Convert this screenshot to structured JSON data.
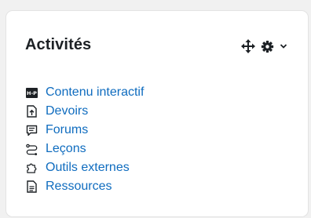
{
  "block": {
    "title": "Activités",
    "items": [
      {
        "label": "Contenu interactif",
        "icon": "h5p-icon"
      },
      {
        "label": "Devoirs",
        "icon": "assignment-icon"
      },
      {
        "label": "Forums",
        "icon": "forum-icon"
      },
      {
        "label": "Leçons",
        "icon": "lesson-icon"
      },
      {
        "label": "Outils externes",
        "icon": "puzzle-icon"
      },
      {
        "label": "Ressources",
        "icon": "resource-icon"
      }
    ],
    "h5p_badge": "H-P"
  },
  "colors": {
    "link": "#0f6cbf",
    "title": "#1d2125",
    "icon": "#1d2125"
  }
}
